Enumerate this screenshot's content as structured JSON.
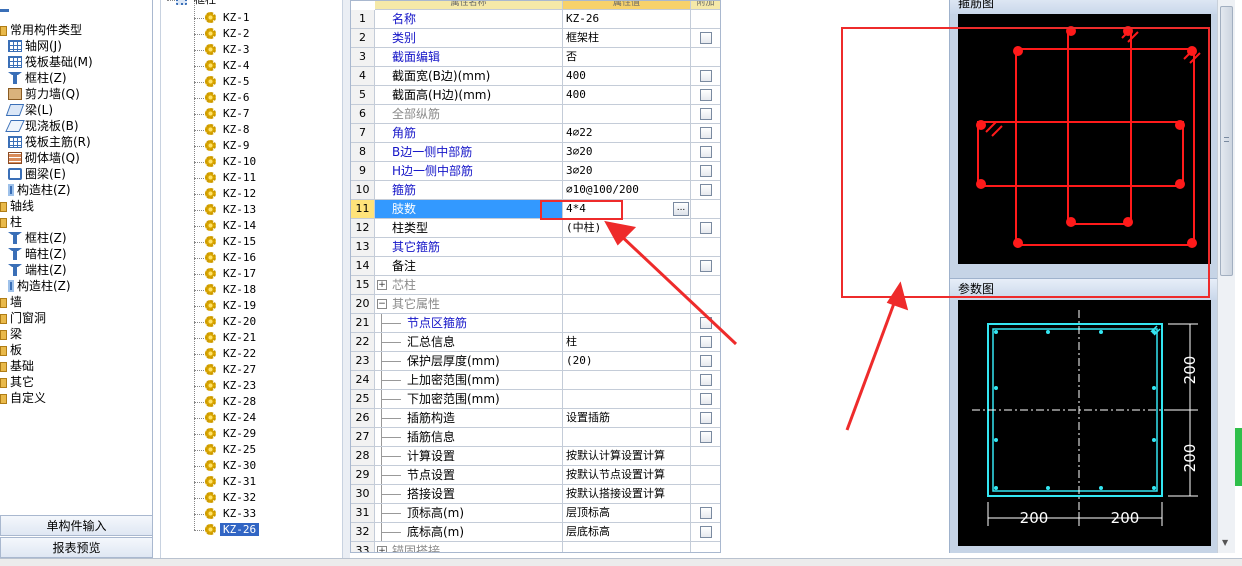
{
  "left_panel": {
    "items": [
      {
        "label": "常用构件类型",
        "icon": "folder-icon",
        "indent": 1
      },
      {
        "label": "轴网(J)",
        "icon": "grid-icon",
        "indent": 2
      },
      {
        "label": "筏板基础(M)",
        "icon": "grid-icon",
        "indent": 2
      },
      {
        "label": "框柱(Z)",
        "icon": "column-icon",
        "indent": 2
      },
      {
        "label": "剪力墙(Q)",
        "icon": "wall-icon",
        "indent": 2
      },
      {
        "label": "梁(L)",
        "icon": "beam-icon",
        "indent": 2
      },
      {
        "label": "现浇板(B)",
        "icon": "slab-icon",
        "indent": 2
      },
      {
        "label": "筏板主筋(R)",
        "icon": "grid-icon",
        "indent": 2
      },
      {
        "label": "砌体墙(Q)",
        "icon": "brick-wall-icon",
        "indent": 2
      },
      {
        "label": "圈梁(E)",
        "icon": "ring-beam-icon",
        "indent": 2
      },
      {
        "label": "构造柱(Z)",
        "icon": "structural-column-icon",
        "indent": 2
      },
      {
        "label": "轴线",
        "icon": "folder-icon",
        "indent": 1
      },
      {
        "label": "柱",
        "icon": "folder-icon",
        "indent": 1
      },
      {
        "label": "框柱(Z)",
        "icon": "column-icon",
        "indent": 2
      },
      {
        "label": "暗柱(Z)",
        "icon": "column-icon",
        "indent": 2
      },
      {
        "label": "端柱(Z)",
        "icon": "column-icon",
        "indent": 2
      },
      {
        "label": "构造柱(Z)",
        "icon": "structural-column-icon",
        "indent": 2
      },
      {
        "label": "墙",
        "icon": "folder-icon",
        "indent": 1
      },
      {
        "label": "门窗洞",
        "icon": "folder-icon",
        "indent": 1
      },
      {
        "label": "梁",
        "icon": "folder-icon",
        "indent": 1
      },
      {
        "label": "板",
        "icon": "folder-icon",
        "indent": 1
      },
      {
        "label": "基础",
        "icon": "folder-icon",
        "indent": 1
      },
      {
        "label": "其它",
        "icon": "folder-icon",
        "indent": 1
      },
      {
        "label": "自定义",
        "icon": "folder-icon",
        "indent": 1
      }
    ],
    "tabs": [
      "单构件输入",
      "报表预览"
    ]
  },
  "tree": {
    "root_label": "框柱",
    "items": [
      "KZ-1",
      "KZ-2",
      "KZ-3",
      "KZ-4",
      "KZ-5",
      "KZ-6",
      "KZ-7",
      "KZ-8",
      "KZ-9",
      "KZ-10",
      "KZ-11",
      "KZ-12",
      "KZ-13",
      "KZ-14",
      "KZ-15",
      "KZ-16",
      "KZ-17",
      "KZ-18",
      "KZ-19",
      "KZ-20",
      "KZ-21",
      "KZ-22",
      "KZ-27",
      "KZ-23",
      "KZ-28",
      "KZ-24",
      "KZ-29",
      "KZ-25",
      "KZ-30",
      "KZ-31",
      "KZ-32",
      "KZ-33",
      "KZ-26"
    ],
    "selected": "KZ-26"
  },
  "grid": {
    "headers": [
      "属性名称",
      "属性值",
      "附加"
    ],
    "rows": [
      {
        "num": "1",
        "name": "名称",
        "value": "KZ-26",
        "style": "blue",
        "check": false
      },
      {
        "num": "2",
        "name": "类别",
        "value": "框架柱",
        "style": "blue",
        "check": true
      },
      {
        "num": "3",
        "name": "截面编辑",
        "value": "否",
        "style": "blue",
        "check": false
      },
      {
        "num": "4",
        "name": "截面宽(B边)(mm)",
        "value": "400",
        "style": "black",
        "check": true
      },
      {
        "num": "5",
        "name": "截面高(H边)(mm)",
        "value": "400",
        "style": "black",
        "check": true
      },
      {
        "num": "6",
        "name": "全部纵筋",
        "value": "",
        "style": "gray",
        "check": true
      },
      {
        "num": "7",
        "name": "角筋",
        "value": "4⌀22",
        "style": "blue",
        "check": true
      },
      {
        "num": "8",
        "name": "B边一侧中部筋",
        "value": "3⌀20",
        "style": "blue",
        "check": true
      },
      {
        "num": "9",
        "name": "H边一侧中部筋",
        "value": "3⌀20",
        "style": "blue",
        "check": true
      },
      {
        "num": "10",
        "name": "箍筋",
        "value": "⌀10@100/200",
        "style": "blue",
        "check": true
      },
      {
        "num": "11",
        "name": "肢数",
        "value": "4*4",
        "style": "blue",
        "check": false,
        "selected": true,
        "ellipsis": "..."
      },
      {
        "num": "12",
        "name": "柱类型",
        "value": "(中柱)",
        "style": "black",
        "check": true
      },
      {
        "num": "13",
        "name": "其它箍筋",
        "value": "",
        "style": "blue",
        "check": false
      },
      {
        "num": "14",
        "name": "备注",
        "value": "",
        "style": "black",
        "check": true
      },
      {
        "num": "15",
        "name": "芯柱",
        "value": "",
        "style": "gray",
        "check": false,
        "expander": "+"
      },
      {
        "num": "20",
        "name": "其它属性",
        "value": "",
        "style": "gray",
        "check": false,
        "expander": "−"
      },
      {
        "num": "21",
        "name": "节点区箍筋",
        "value": "",
        "style": "blue",
        "check": true,
        "sub": true
      },
      {
        "num": "22",
        "name": "汇总信息",
        "value": "柱",
        "style": "black",
        "check": true,
        "sub": true
      },
      {
        "num": "23",
        "name": "保护层厚度(mm)",
        "value": "(20)",
        "style": "black",
        "check": true,
        "sub": true
      },
      {
        "num": "24",
        "name": "上加密范围(mm)",
        "value": "",
        "style": "black",
        "check": true,
        "sub": true
      },
      {
        "num": "25",
        "name": "下加密范围(mm)",
        "value": "",
        "style": "black",
        "check": true,
        "sub": true
      },
      {
        "num": "26",
        "name": "插筋构造",
        "value": "设置插筋",
        "style": "black",
        "check": true,
        "sub": true
      },
      {
        "num": "27",
        "name": "插筋信息",
        "value": "",
        "style": "black",
        "check": true,
        "sub": true
      },
      {
        "num": "28",
        "name": "计算设置",
        "value": "按默认计算设置计算",
        "style": "black",
        "check": false,
        "sub": true
      },
      {
        "num": "29",
        "name": "节点设置",
        "value": "按默认节点设置计算",
        "style": "black",
        "check": false,
        "sub": true
      },
      {
        "num": "30",
        "name": "搭接设置",
        "value": "按默认搭接设置计算",
        "style": "black",
        "check": false,
        "sub": true
      },
      {
        "num": "31",
        "name": "顶标高(m)",
        "value": "层顶标高",
        "style": "black",
        "check": true,
        "sub": true
      },
      {
        "num": "32",
        "name": "底标高(m)",
        "value": "层底标高",
        "style": "black",
        "check": true,
        "sub": true
      },
      {
        "num": "33",
        "name": "锚固搭接",
        "value": "",
        "style": "gray",
        "check": false,
        "expander": "+"
      }
    ]
  },
  "right_panel": {
    "rebar_title": "箍筋图",
    "param_title": "参数图",
    "dims": {
      "vertical_top": "200",
      "vertical_bottom": "200",
      "horizontal_left": "200",
      "horizontal_right": "200"
    }
  },
  "colors": {
    "annotation_red": "#ee2b2b",
    "selection_blue": "#3399ff",
    "rebar_red": "#ff1a1a",
    "param_cyan": "#34e6f2"
  }
}
